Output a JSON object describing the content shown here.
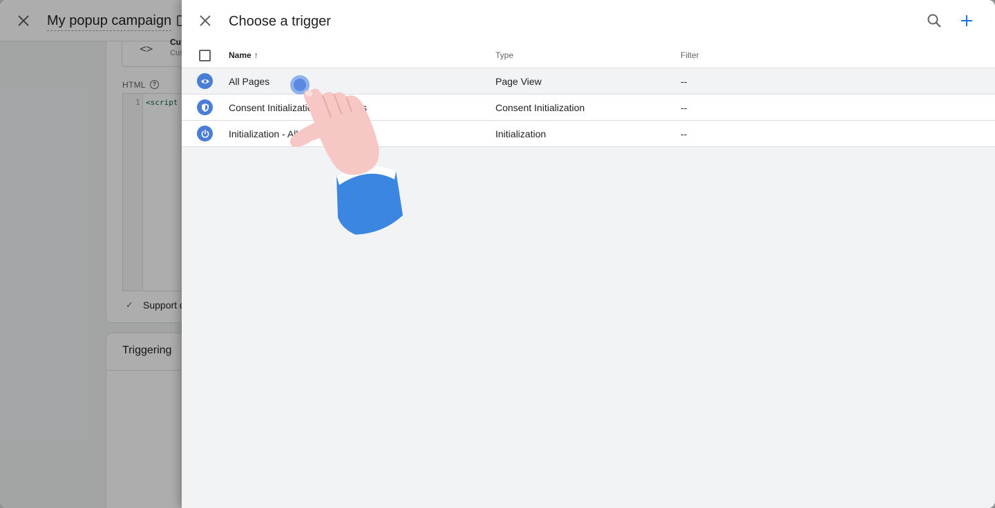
{
  "background_editor": {
    "tag_name": "My popup campaign",
    "tag_type_name": "Cu",
    "tag_type_sub": "Cus",
    "html_label": "HTML",
    "code_line_number": "1",
    "code_line_text": "<script",
    "support_label": "Support d",
    "triggering_label": "Triggering"
  },
  "panel": {
    "title": "Choose a trigger",
    "columns": {
      "name": "Name",
      "type": "Type",
      "filter": "Filter"
    },
    "sort_indicator": "↑",
    "rows": [
      {
        "name": "All Pages",
        "type": "Page View",
        "filter": "--",
        "icon": "eye-icon"
      },
      {
        "name": "Consent Initialization - All Pages",
        "type": "Consent Initialization",
        "filter": "--",
        "icon": "shield-icon"
      },
      {
        "name": "Initialization - All Pages",
        "type": "Initialization",
        "filter": "--",
        "icon": "power-icon"
      }
    ],
    "hovered_row": 0
  },
  "colors": {
    "accent": "#1a73e8",
    "trigger_icon": "#4a7dd6",
    "hand_skin": "#f6c7c4",
    "hand_sleeve": "#3a86e0"
  },
  "icons": {
    "close": "close-icon",
    "search": "search-icon",
    "add": "plus-icon",
    "pointer": "pointing-hand-icon"
  }
}
